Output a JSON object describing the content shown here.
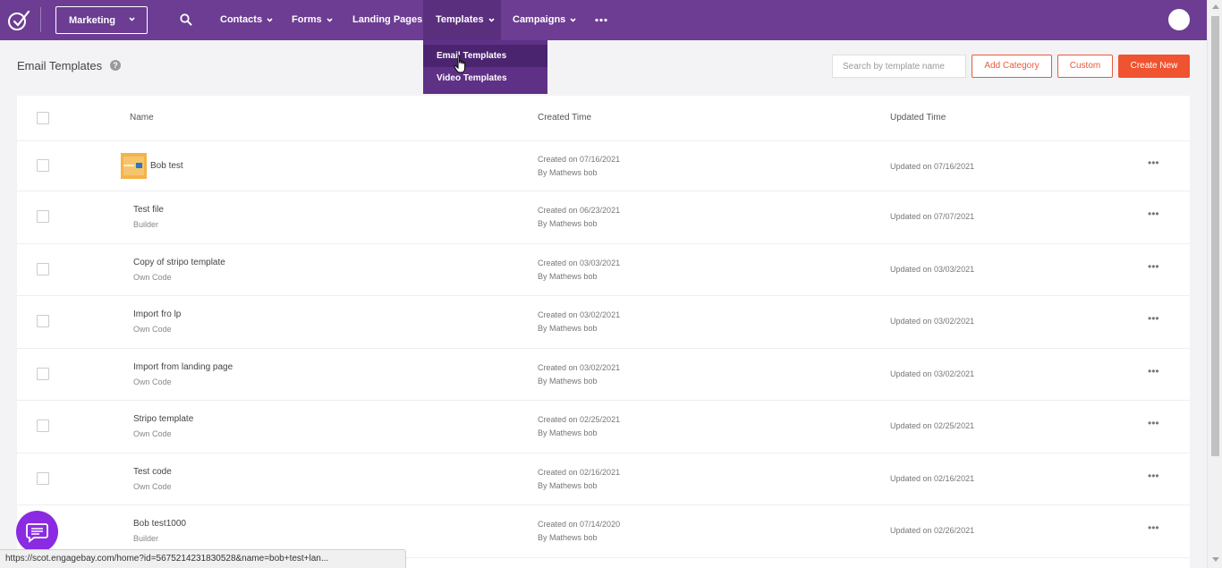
{
  "nav": {
    "module_select": "Marketing",
    "items": [
      {
        "label": "Contacts"
      },
      {
        "label": "Forms"
      },
      {
        "label": "Landing Pages"
      },
      {
        "label": "Templates"
      },
      {
        "label": "Campaigns"
      }
    ],
    "active_item": "Templates",
    "dropdown": [
      {
        "label": "Email Templates"
      },
      {
        "label": "Video Templates"
      }
    ]
  },
  "header": {
    "title": "Email Templates",
    "help_glyph": "?",
    "search_placeholder": "Search by template name",
    "add_category_label": "Add Category",
    "custom_label": "Custom",
    "create_new_label": "Create New"
  },
  "table": {
    "columns": {
      "name": "Name",
      "created": "Created Time",
      "updated": "Updated Time"
    },
    "rows": [
      {
        "name": "Bob test",
        "type": "",
        "created": "Created on 07/16/2021",
        "by": "By Mathews bob",
        "updated": "Updated on 07/16/2021"
      },
      {
        "name": "Test file",
        "type": "Builder",
        "created": "Created on 06/23/2021",
        "by": "By Mathews bob",
        "updated": "Updated on 07/07/2021"
      },
      {
        "name": "Copy of stripo template",
        "type": "Own Code",
        "created": "Created on 03/03/2021",
        "by": "By Mathews bob",
        "updated": "Updated on 03/03/2021"
      },
      {
        "name": "Import fro lp",
        "type": "Own Code",
        "created": "Created on 03/02/2021",
        "by": "By Mathews bob",
        "updated": "Updated on 03/02/2021"
      },
      {
        "name": "Import from landing page",
        "type": "Own Code",
        "created": "Created on 03/02/2021",
        "by": "By Mathews bob",
        "updated": "Updated on 03/02/2021"
      },
      {
        "name": "Stripo template",
        "type": "Own Code",
        "created": "Created on 02/25/2021",
        "by": "By Mathews bob",
        "updated": "Updated on 02/25/2021"
      },
      {
        "name": "Test code",
        "type": "Own Code",
        "created": "Created on 02/16/2021",
        "by": "By Mathews bob",
        "updated": "Updated on 02/16/2021"
      },
      {
        "name": "Bob test1000",
        "type": "Builder",
        "created": "Created on 07/14/2020",
        "by": "By Mathews bob",
        "updated": "Updated on 02/26/2021"
      }
    ],
    "row_menu_glyph": "•••"
  },
  "status_bar": {
    "url": "https://scot.engagebay.com/home?id=5675214231830528&name=bob+test+lan..."
  },
  "colors": {
    "nav_bg": "#6c3d92",
    "dropdown_bg": "#5e3187",
    "accent": "#f0532f",
    "chat": "#8a2be2"
  }
}
